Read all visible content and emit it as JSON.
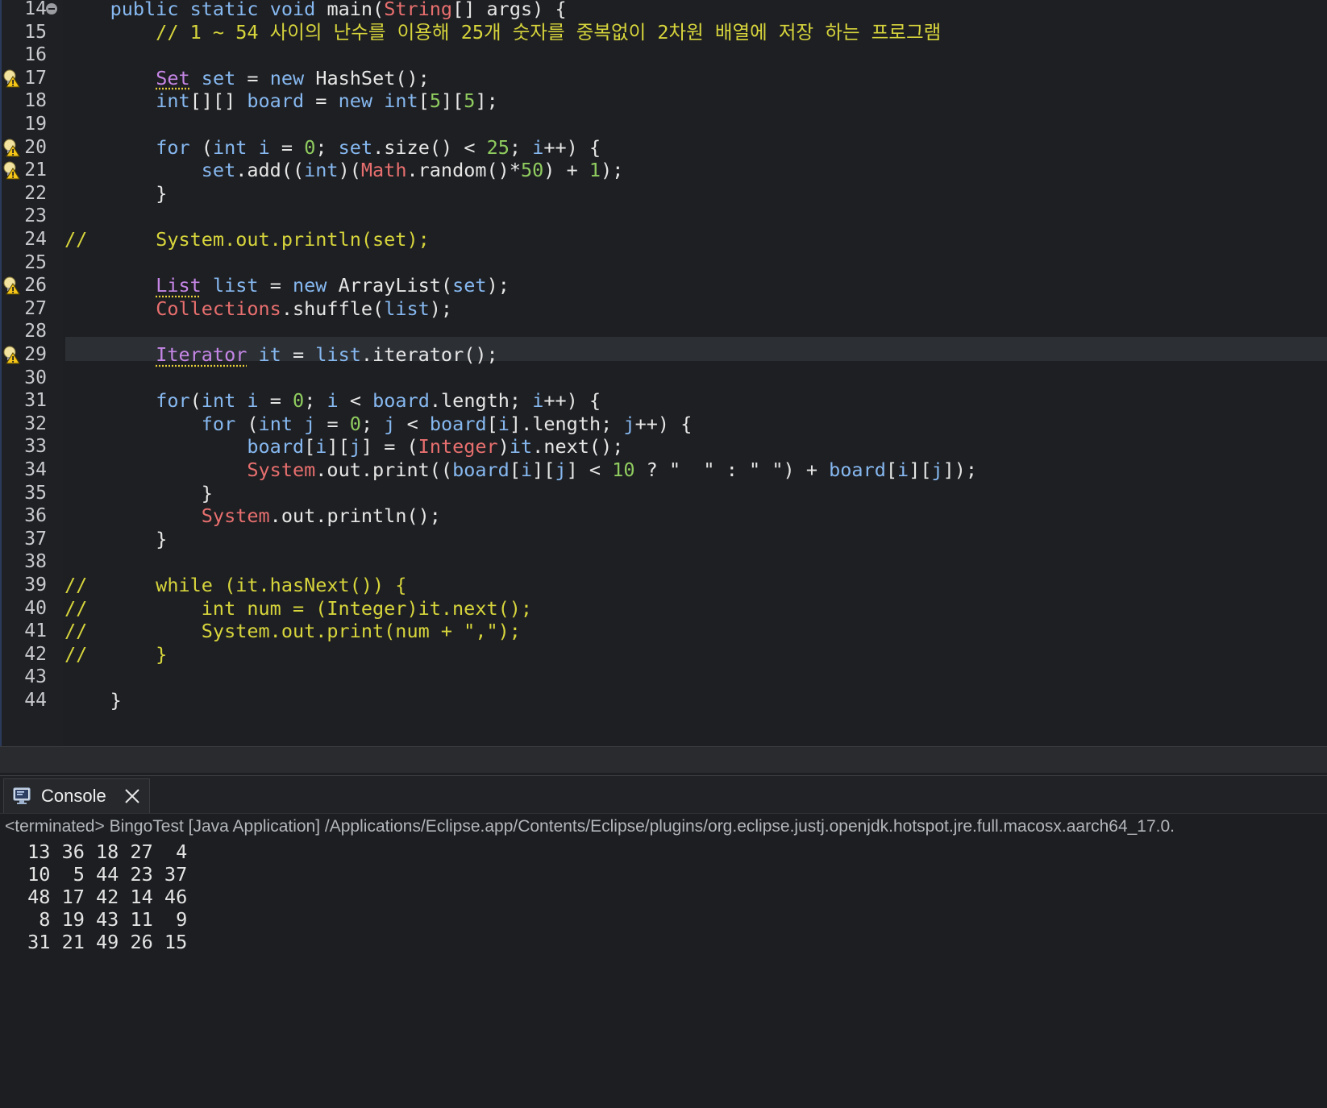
{
  "editor": {
    "current_line": 28,
    "lines": [
      {
        "n": "14",
        "fold": true,
        "warn": false,
        "code": "    public static void main(String[] args) {"
      },
      {
        "n": "15",
        "warn": false,
        "code": "        // 1 ~ 54 사이의 난수를 이용해 25개 숫자를 중복없이 2차원 배열에 저장 하는 프로그램"
      },
      {
        "n": "16",
        "warn": false,
        "code": ""
      },
      {
        "n": "17",
        "warn": true,
        "code": "        Set set = new HashSet();"
      },
      {
        "n": "18",
        "warn": false,
        "code": "        int[][] board = new int[5][5];"
      },
      {
        "n": "19",
        "warn": false,
        "code": ""
      },
      {
        "n": "20",
        "warn": true,
        "code": "        for (int i = 0; set.size() < 25; i++) {"
      },
      {
        "n": "21",
        "warn": true,
        "code": "            set.add((int)(Math.random()*50) + 1);"
      },
      {
        "n": "22",
        "warn": false,
        "code": "        }"
      },
      {
        "n": "23",
        "warn": false,
        "code": ""
      },
      {
        "n": "24",
        "warn": false,
        "code": "//      System.out.println(set);"
      },
      {
        "n": "25",
        "warn": false,
        "code": ""
      },
      {
        "n": "26",
        "warn": true,
        "code": "        List list = new ArrayList(set);"
      },
      {
        "n": "27",
        "warn": false,
        "code": "        Collections.shuffle(list);"
      },
      {
        "n": "28",
        "warn": false,
        "code": ""
      },
      {
        "n": "29",
        "warn": true,
        "code": "        Iterator it = list.iterator();"
      },
      {
        "n": "30",
        "warn": false,
        "code": ""
      },
      {
        "n": "31",
        "warn": false,
        "code": "        for(int i = 0; i < board.length; i++) {"
      },
      {
        "n": "32",
        "warn": false,
        "code": "            for (int j = 0; j < board[i].length; j++) {"
      },
      {
        "n": "33",
        "warn": false,
        "code": "                board[i][j] = (Integer)it.next();"
      },
      {
        "n": "34",
        "warn": false,
        "code": "                System.out.print((board[i][j] < 10 ? \"  \" : \" \") + board[i][j]);"
      },
      {
        "n": "35",
        "warn": false,
        "code": "            }"
      },
      {
        "n": "36",
        "warn": false,
        "code": "            System.out.println();"
      },
      {
        "n": "37",
        "warn": false,
        "code": "        }"
      },
      {
        "n": "38",
        "warn": false,
        "code": ""
      },
      {
        "n": "39",
        "warn": false,
        "code": "//      while (it.hasNext()) {"
      },
      {
        "n": "40",
        "warn": false,
        "code": "//          int num = (Integer)it.next();"
      },
      {
        "n": "41",
        "warn": false,
        "code": "//          System.out.print(num + \",\");"
      },
      {
        "n": "42",
        "warn": false,
        "code": "//      }"
      },
      {
        "n": "43",
        "warn": false,
        "code": ""
      },
      {
        "n": "44",
        "warn": false,
        "code": "    }"
      }
    ]
  },
  "console": {
    "tab_label": "Console",
    "status": "<terminated> BingoTest [Java Application] /Applications/Eclipse.app/Contents/Eclipse/plugins/org.eclipse.justj.openjdk.hotspot.jre.full.macosx.aarch64_17.0.",
    "output": [
      " 13 36 18 27  4",
      " 10  5 44 23 37",
      " 48 17 42 14 46",
      "  8 19 43 11  9",
      " 31 21 49 26 15"
    ]
  },
  "colors": {
    "background": "#1e1f22",
    "keyword": "#86b8f0",
    "class": "#e86f6f",
    "number": "#8fcc5f",
    "comment": "#d7d53c",
    "warning_icon": "#e8cf3a"
  },
  "icons": {
    "warning": "lightbulb-warning-icon",
    "fold": "fold-collapse-icon",
    "console": "console-monitor-icon",
    "close": "close-icon"
  }
}
